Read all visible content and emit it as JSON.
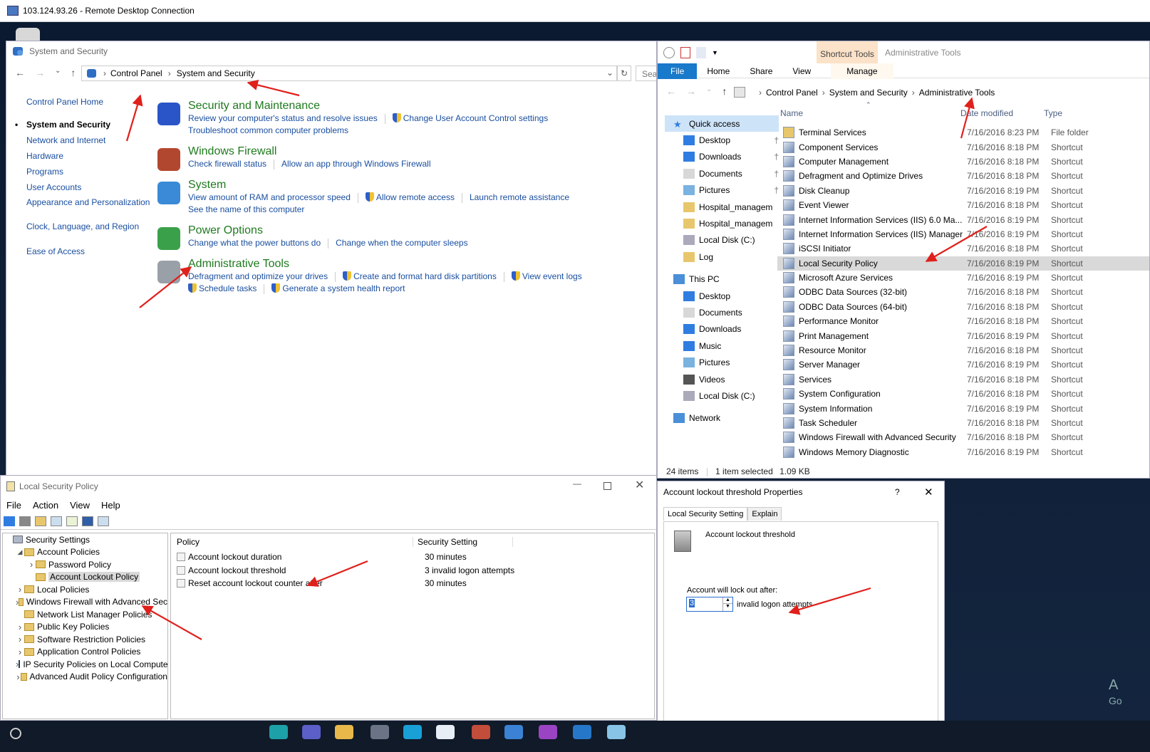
{
  "rdp": {
    "title": "103.124.93.26 - Remote Desktop Connection"
  },
  "colors": {
    "accent": "#1979ca",
    "annotation_arrow": "#e0201b",
    "cp_heading": "#1f7a1f",
    "link": "#1a4fa0"
  },
  "control_panel": {
    "window_title": "System and Security",
    "breadcrumb": [
      "Control Panel",
      "System and Security"
    ],
    "search_placeholder": "Sear",
    "left_nav": [
      "Control Panel Home",
      "System and Security",
      "Network and Internet",
      "Hardware",
      "Programs",
      "User Accounts",
      "Appearance and Personalization",
      "Clock, Language, and Region",
      "Ease of Access"
    ],
    "left_nav_active": "System and Security",
    "sections": [
      {
        "icon": "flag-icon",
        "title": "Security and Maintenance",
        "links": [
          [
            "Review your computer's status and resolve issues",
            "Change User Account Control settings"
          ],
          [
            "Troubleshoot common computer problems"
          ]
        ]
      },
      {
        "icon": "firewall-icon",
        "title": "Windows Firewall",
        "links": [
          [
            "Check firewall status",
            "Allow an app through Windows Firewall"
          ]
        ]
      },
      {
        "icon": "computer-icon",
        "title": "System",
        "links": [
          [
            "View amount of RAM and processor speed",
            "Allow remote access",
            "Launch remote assistance"
          ],
          [
            "See the name of this computer"
          ]
        ]
      },
      {
        "icon": "power-icon",
        "title": "Power Options",
        "links": [
          [
            "Change what the power buttons do",
            "Change when the computer sleeps"
          ]
        ]
      },
      {
        "icon": "admin-tools-icon",
        "title": "Administrative Tools",
        "links": [
          [
            "Defragment and optimize your drives",
            "Create and format hard disk partitions",
            "View event logs"
          ],
          [
            "Schedule tasks",
            "Generate a system health report"
          ]
        ]
      }
    ],
    "shielded_links": [
      "Change User Account Control settings",
      "Allow remote access",
      "Create and format hard disk partitions",
      "View event logs",
      "Schedule tasks",
      "Generate a system health report"
    ]
  },
  "explorer": {
    "context_tab": "Shortcut Tools",
    "window_title": "Administrative Tools",
    "tabs": [
      "File",
      "Home",
      "Share",
      "View",
      "Manage"
    ],
    "breadcrumb": [
      "Control Panel",
      "System and Security",
      "Administrative Tools"
    ],
    "nav": [
      {
        "label": "Quick access",
        "icon": "star-icon",
        "level": 0,
        "selected": true
      },
      {
        "label": "Desktop",
        "icon": "desktop-icon",
        "level": 1,
        "pinned": true
      },
      {
        "label": "Downloads",
        "icon": "download-icon",
        "level": 1,
        "pinned": true
      },
      {
        "label": "Documents",
        "icon": "documents-icon",
        "level": 1,
        "pinned": true
      },
      {
        "label": "Pictures",
        "icon": "pictures-icon",
        "level": 1,
        "pinned": true
      },
      {
        "label": "Hospital_managem",
        "icon": "folder-icon",
        "level": 1
      },
      {
        "label": "Hospital_managem",
        "icon": "folder-icon",
        "level": 1
      },
      {
        "label": "Local Disk (C:)",
        "icon": "disk-icon",
        "level": 1
      },
      {
        "label": "Log",
        "icon": "folder-icon",
        "level": 1
      },
      {
        "label": "This PC",
        "icon": "pc-icon",
        "level": 0,
        "gap": true
      },
      {
        "label": "Desktop",
        "icon": "desktop-icon",
        "level": 1
      },
      {
        "label": "Documents",
        "icon": "documents-icon",
        "level": 1
      },
      {
        "label": "Downloads",
        "icon": "download-icon",
        "level": 1
      },
      {
        "label": "Music",
        "icon": "music-icon",
        "level": 1
      },
      {
        "label": "Pictures",
        "icon": "pictures-icon",
        "level": 1
      },
      {
        "label": "Videos",
        "icon": "videos-icon",
        "level": 1
      },
      {
        "label": "Local Disk (C:)",
        "icon": "disk-icon",
        "level": 1
      },
      {
        "label": "Network",
        "icon": "network-icon",
        "level": 0,
        "gap": true
      }
    ],
    "columns": [
      "Name",
      "Date modified",
      "Type"
    ],
    "files": [
      {
        "name": "Terminal Services",
        "date": "7/16/2016 8:23 PM",
        "type": "File folder",
        "icon": "folder-icon"
      },
      {
        "name": "Component Services",
        "date": "7/16/2016 8:18 PM",
        "type": "Shortcut",
        "icon": "component-services-icon"
      },
      {
        "name": "Computer Management",
        "date": "7/16/2016 8:18 PM",
        "type": "Shortcut",
        "icon": "computer-management-icon"
      },
      {
        "name": "Defragment and Optimize Drives",
        "date": "7/16/2016 8:18 PM",
        "type": "Shortcut",
        "icon": "defrag-icon"
      },
      {
        "name": "Disk Cleanup",
        "date": "7/16/2016 8:19 PM",
        "type": "Shortcut",
        "icon": "disk-cleanup-icon"
      },
      {
        "name": "Event Viewer",
        "date": "7/16/2016 8:18 PM",
        "type": "Shortcut",
        "icon": "event-viewer-icon"
      },
      {
        "name": "Internet Information Services (IIS) 6.0 Ma...",
        "date": "7/16/2016 8:19 PM",
        "type": "Shortcut",
        "icon": "iis-icon"
      },
      {
        "name": "Internet Information Services (IIS) Manager",
        "date": "7/16/2016 8:19 PM",
        "type": "Shortcut",
        "icon": "iis-icon"
      },
      {
        "name": "iSCSI Initiator",
        "date": "7/16/2016 8:18 PM",
        "type": "Shortcut",
        "icon": "iscsi-icon"
      },
      {
        "name": "Local Security Policy",
        "date": "7/16/2016 8:19 PM",
        "type": "Shortcut",
        "icon": "security-policy-icon",
        "selected": true
      },
      {
        "name": "Microsoft Azure Services",
        "date": "7/16/2016 8:19 PM",
        "type": "Shortcut",
        "icon": "azure-icon"
      },
      {
        "name": "ODBC Data Sources (32-bit)",
        "date": "7/16/2016 8:18 PM",
        "type": "Shortcut",
        "icon": "odbc-icon"
      },
      {
        "name": "ODBC Data Sources (64-bit)",
        "date": "7/16/2016 8:18 PM",
        "type": "Shortcut",
        "icon": "odbc-icon"
      },
      {
        "name": "Performance Monitor",
        "date": "7/16/2016 8:18 PM",
        "type": "Shortcut",
        "icon": "perf-monitor-icon"
      },
      {
        "name": "Print Management",
        "date": "7/16/2016 8:19 PM",
        "type": "Shortcut",
        "icon": "printer-icon"
      },
      {
        "name": "Resource Monitor",
        "date": "7/16/2016 8:18 PM",
        "type": "Shortcut",
        "icon": "resource-monitor-icon"
      },
      {
        "name": "Server Manager",
        "date": "7/16/2016 8:19 PM",
        "type": "Shortcut",
        "icon": "server-manager-icon"
      },
      {
        "name": "Services",
        "date": "7/16/2016 8:18 PM",
        "type": "Shortcut",
        "icon": "services-icon"
      },
      {
        "name": "System Configuration",
        "date": "7/16/2016 8:18 PM",
        "type": "Shortcut",
        "icon": "sysconfig-icon"
      },
      {
        "name": "System Information",
        "date": "7/16/2016 8:19 PM",
        "type": "Shortcut",
        "icon": "sysinfo-icon"
      },
      {
        "name": "Task Scheduler",
        "date": "7/16/2016 8:18 PM",
        "type": "Shortcut",
        "icon": "task-scheduler-icon"
      },
      {
        "name": "Windows Firewall with Advanced Security",
        "date": "7/16/2016 8:18 PM",
        "type": "Shortcut",
        "icon": "firewall-icon"
      },
      {
        "name": "Windows Memory Diagnostic",
        "date": "7/16/2016 8:19 PM",
        "type": "Shortcut",
        "icon": "memory-diag-icon"
      }
    ],
    "status": {
      "count": "24 items",
      "selected": "1 item selected",
      "size": "1.09 KB"
    }
  },
  "lsp": {
    "title": "Local Security Policy",
    "menu": [
      "File",
      "Action",
      "View",
      "Help"
    ],
    "tree": [
      {
        "label": "Security Settings",
        "level": 0,
        "expand": "",
        "icon": "security-settings-icon"
      },
      {
        "label": "Account Policies",
        "level": 1,
        "expand": "open"
      },
      {
        "label": "Password Policy",
        "level": 2,
        "expand": "closed"
      },
      {
        "label": "Account Lockout Policy",
        "level": 2,
        "expand": "",
        "selected": true
      },
      {
        "label": "Local Policies",
        "level": 1,
        "expand": "closed"
      },
      {
        "label": "Windows Firewall with Advanced Sec",
        "level": 1,
        "expand": "closed"
      },
      {
        "label": "Network List Manager Policies",
        "level": 1,
        "expand": ""
      },
      {
        "label": "Public Key Policies",
        "level": 1,
        "expand": "closed"
      },
      {
        "label": "Software Restriction Policies",
        "level": 1,
        "expand": "closed"
      },
      {
        "label": "Application Control Policies",
        "level": 1,
        "expand": "closed"
      },
      {
        "label": "IP Security Policies on Local Compute",
        "level": 1,
        "expand": "closed",
        "icon": "ip-security-icon"
      },
      {
        "label": "Advanced Audit Policy Configuration",
        "level": 1,
        "expand": "closed"
      }
    ],
    "columns": [
      "Policy",
      "Security Setting"
    ],
    "policies": [
      {
        "policy": "Account lockout duration",
        "setting": "30 minutes"
      },
      {
        "policy": "Account lockout threshold",
        "setting": "3 invalid logon attempts"
      },
      {
        "policy": "Reset account lockout counter after",
        "setting": "30 minutes"
      }
    ]
  },
  "dialog": {
    "title": "Account lockout threshold Properties",
    "help": "?",
    "tabs": [
      "Local Security Setting",
      "Explain"
    ],
    "heading": "Account lockout threshold",
    "label": "Account will lock out after:",
    "value": "3",
    "suffix": "invalid logon attempts"
  },
  "watermark": {
    "lines": [
      "A",
      "Go"
    ]
  }
}
